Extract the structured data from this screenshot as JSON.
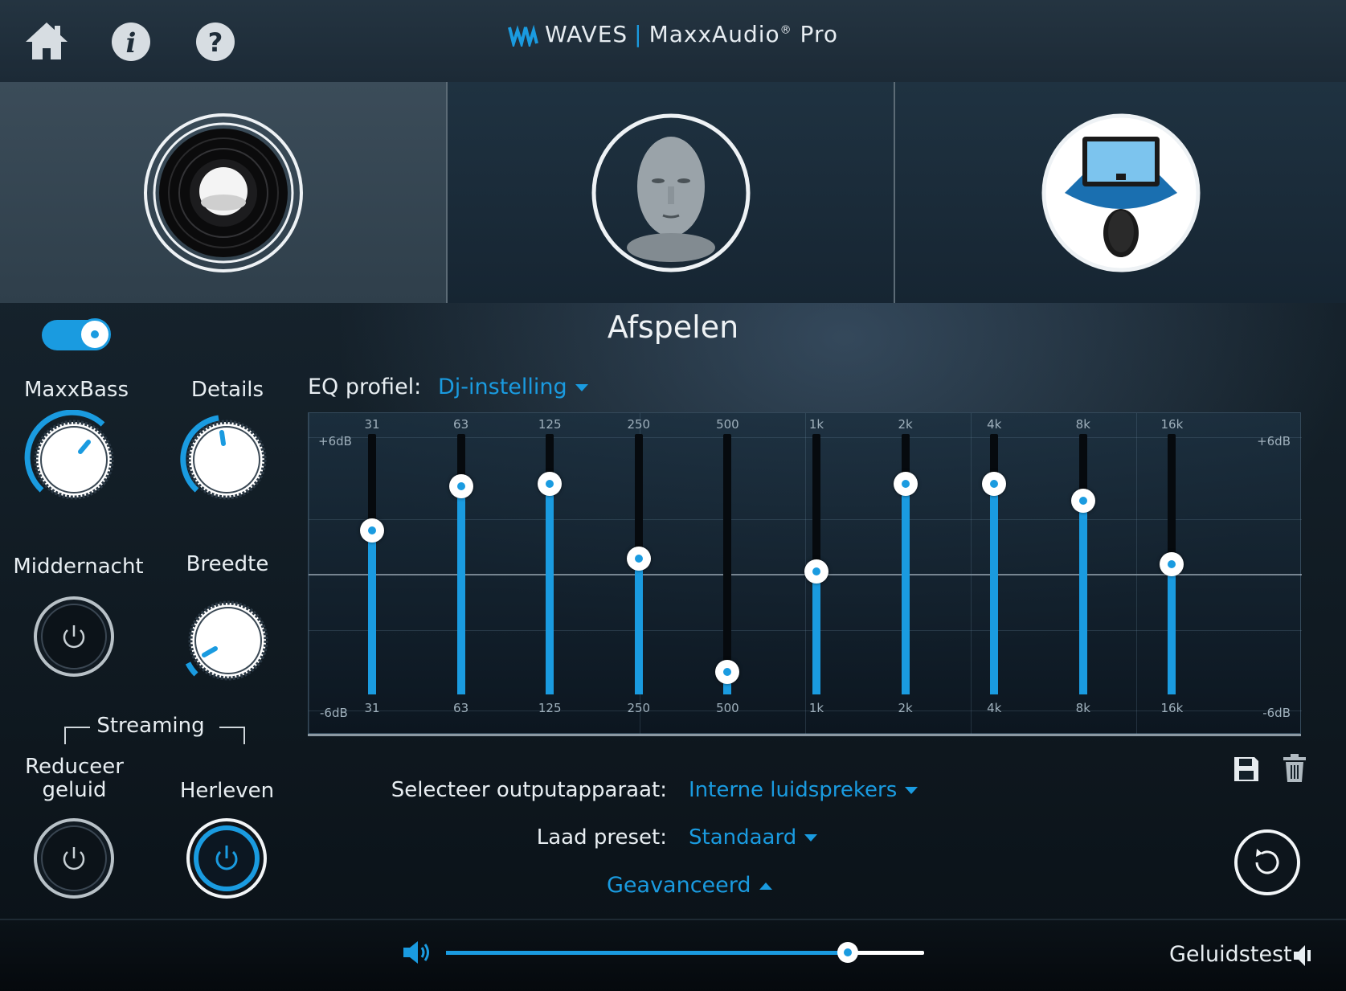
{
  "header": {
    "brand_left": "WAVES",
    "brand_right": "MaxxAudio",
    "brand_reg": "®",
    "brand_suffix": "Pro",
    "icons": [
      "home-icon",
      "info-icon",
      "help-icon"
    ]
  },
  "modes": [
    {
      "name": "speaker-mode",
      "selected": true
    },
    {
      "name": "headphones-mode",
      "selected": false
    },
    {
      "name": "laptop-listener-mode",
      "selected": false
    }
  ],
  "section_title": "Afspelen",
  "left_controls": {
    "maxxbass_enabled": true,
    "maxxbass": "MaxxBass",
    "details": "Details",
    "middernacht": "Middernacht",
    "breedte": "Breedte",
    "streaming": "Streaming",
    "reduceer_line1": "Reduceer",
    "reduceer_line2": "geluid",
    "herleven": "Herleven",
    "herleven_on": true
  },
  "eq": {
    "label": "EQ profiel:",
    "profile": "Dj-instelling",
    "db_top": "+6dB",
    "db_bottom": "-6dB",
    "bands": [
      {
        "freq": "31",
        "gain": 1.8
      },
      {
        "freq": "63",
        "gain": 4.2
      },
      {
        "freq": "125",
        "gain": 4.3
      },
      {
        "freq": "250",
        "gain": 0.3
      },
      {
        "freq": "500",
        "gain": -5.8
      },
      {
        "freq": "1k",
        "gain": -0.4
      },
      {
        "freq": "2k",
        "gain": 4.3
      },
      {
        "freq": "4k",
        "gain": 4.3
      },
      {
        "freq": "8k",
        "gain": 3.4
      },
      {
        "freq": "16k",
        "gain": 0.0
      }
    ]
  },
  "output": {
    "label": "Selecteer outputapparaat:",
    "value": "Interne luidsprekers"
  },
  "preset": {
    "label": "Laad preset:",
    "value": "Standaard"
  },
  "advanced": "Geavanceerd",
  "footer": {
    "volume_pct": 84,
    "soundtest": "Geluidstest"
  },
  "colors": {
    "accent": "#1a9be0",
    "background": "#142029"
  }
}
